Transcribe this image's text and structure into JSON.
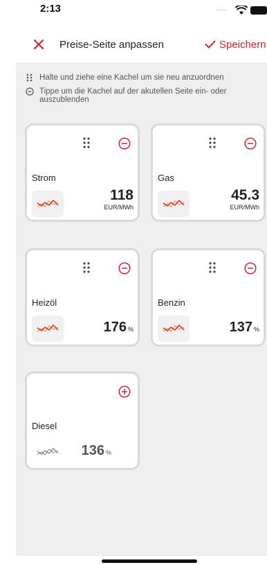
{
  "status": {
    "time": "2:13",
    "signal": "...."
  },
  "nav": {
    "title": "Preise-Seite anpassen",
    "save_label": "Speichern"
  },
  "hints": [
    {
      "icon": "drag-handle-icon",
      "text": "Halte und ziehe eine Kachel um sie neu anzuordnen"
    },
    {
      "icon": "minus-circle-icon",
      "text": "Tippe um die Kachel auf der akutellen Seite ein- oder auszublenden"
    }
  ],
  "tiles": [
    {
      "name": "Strom",
      "value": "118",
      "unit": "EUR/MWh",
      "state": "visible"
    },
    {
      "name": "Gas",
      "value": "45.3",
      "unit": "EUR/MWh",
      "state": "visible"
    },
    {
      "name": "Heizöl",
      "value": "176",
      "unit": "%",
      "state": "visible"
    },
    {
      "name": "Benzin",
      "value": "137",
      "unit": "%",
      "state": "visible"
    },
    {
      "name": "Diesel",
      "value": "136",
      "unit": "%",
      "state": "hidden"
    }
  ],
  "colors": {
    "accent": "#d7202f",
    "trend_active_a": "#d7202f",
    "trend_active_b": "#f2a14a",
    "trend_inactive": "#888888",
    "background": "#efefef"
  }
}
